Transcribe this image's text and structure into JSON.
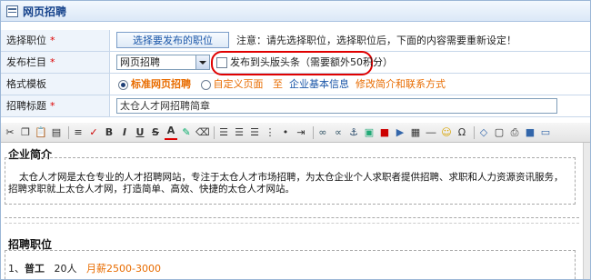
{
  "window": {
    "title": "网页招聘"
  },
  "form": {
    "position": {
      "label": "选择职位",
      "button": "选择要发布的职位",
      "note": "注意：请先选择职位，选择职位后，下面的内容需要重新设定！"
    },
    "column": {
      "label": "发布栏目",
      "value": "网页招聘",
      "checkbox": "发布到头版头条（需要额外50积分）"
    },
    "template": {
      "label": "格式模板",
      "option1": "标准网页招聘",
      "option2": "自定义页面",
      "to": "至",
      "link": "企业基本信息",
      "link2": "修改简介和联系方式"
    },
    "title": {
      "label": "招聘标题",
      "value": "太仓人才网招聘简章"
    },
    "required_mark": "*"
  },
  "editor": {
    "toolbar_icons": [
      "cut-icon",
      "copy-icon",
      "paste-icon",
      "paste-text-icon",
      "paste-word-icon",
      "format-icon",
      "spell-icon",
      "bold-icon",
      "italic-icon",
      "underline-icon",
      "strike-icon",
      "font-color-icon",
      "highlight-icon",
      "eraser-icon",
      "align-left-icon",
      "align-center-icon",
      "align-right-icon",
      "align-justify-icon",
      "list-ol-icon",
      "list-ul-icon",
      "link-icon",
      "unlink-icon",
      "anchor-icon",
      "image-icon",
      "flash-icon",
      "media-icon",
      "table-icon",
      "hr-icon",
      "smiley-icon",
      "specialchar-icon",
      "source-icon",
      "preview-icon",
      "print-icon",
      "fullscreen-icon",
      "about-icon"
    ],
    "section1_title": "企业简介",
    "section1_text": "太仓人才网是太仓专业的人才招聘网站，专注于太仓人才市场招聘，为太仓企业个人求职者提供招聘、求职和人力资源资讯服务，招聘求职就上太仓人才网，打造简单、高效、快捷的太仓人才网站。",
    "section2_title": "招聘职位",
    "job": {
      "index": "1、",
      "name": "普工",
      "count": "20人",
      "salary": "月薪2500-3000"
    }
  },
  "colors": {
    "highlight_oval": "#e00000",
    "link_blue": "#1a56a8",
    "orange": "#e86c00"
  }
}
